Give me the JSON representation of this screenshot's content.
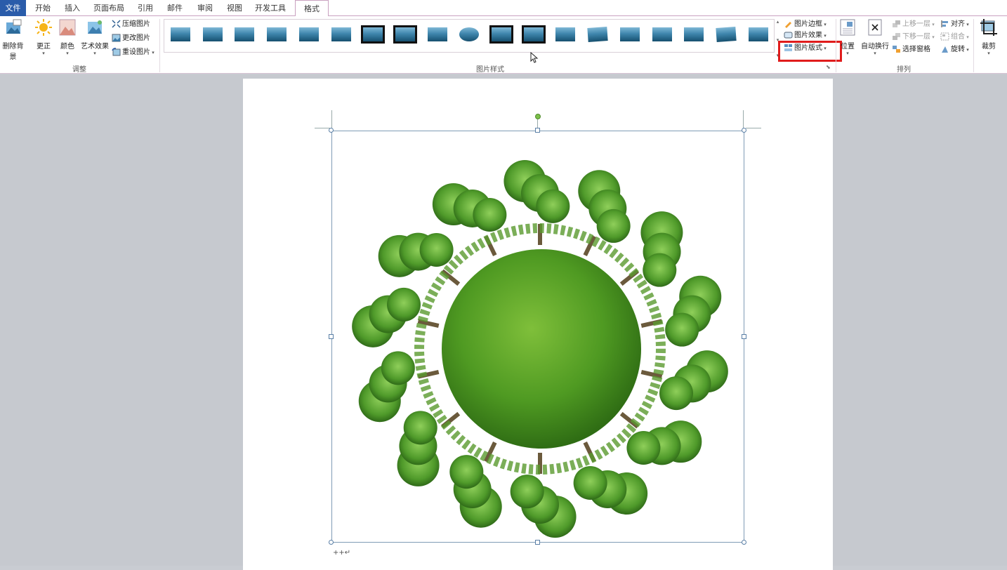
{
  "tabs": [
    "文件",
    "开始",
    "插入",
    "页面布局",
    "引用",
    "邮件",
    "审阅",
    "视图",
    "开发工具",
    "格式"
  ],
  "adjust_group": {
    "label": "调整",
    "remove_bg": "删除背景",
    "correct": "更正",
    "color": "颜色",
    "artistic": "艺术效果",
    "compress": "压缩图片",
    "change": "更改图片",
    "reset": "重设图片"
  },
  "styles_group": {
    "label": "图片样式",
    "border": "图片边框",
    "effects": "图片效果",
    "layout": "图片版式"
  },
  "arrange_group": {
    "label": "排列",
    "position": "位置",
    "wrap": "自动换行",
    "forward": "上移一层",
    "backward": "下移一层",
    "selection_pane": "选择窗格",
    "align": "对齐",
    "group": "组合",
    "rotate": "旋转"
  },
  "size_group": {
    "crop": "裁剪"
  },
  "document": {
    "paragraph_mark": "++↵"
  },
  "colors": {
    "file_tab": "#2a5caa",
    "highlight_box": "#e01c1c",
    "selected_style": "#fde9a8"
  }
}
